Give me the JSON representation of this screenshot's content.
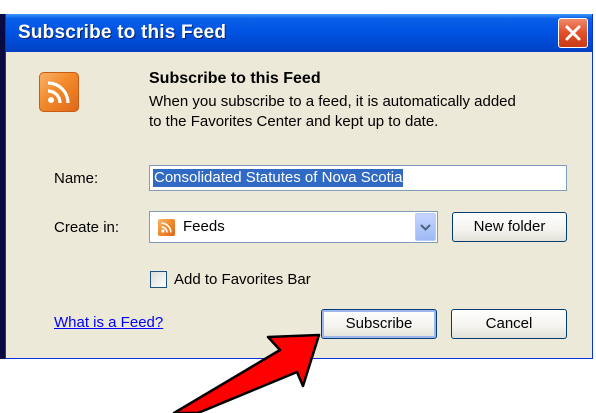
{
  "window": {
    "title": "Subscribe to this Feed",
    "close_label": "Close"
  },
  "header": {
    "title": "Subscribe to this Feed",
    "description_line1": "When you subscribe to a feed, it is automatically added",
    "description_line2": "to the Favorites Center and kept up to date."
  },
  "form": {
    "name_label": "Name:",
    "name_value": "Consolidated Statutes of Nova Scotia",
    "create_in_label": "Create in:",
    "create_in_value": "Feeds",
    "new_folder_label": "New folder",
    "favorites_bar_label": "Add to Favorites Bar",
    "favorites_bar_checked": false
  },
  "footer": {
    "help_link": "What is a Feed?",
    "subscribe_label": "Subscribe",
    "cancel_label": "Cancel"
  },
  "icons": {
    "feed": "rss-feed-icon",
    "close": "close-icon",
    "dropdown": "chevron-down-icon",
    "annotation": "red-arrow-icon"
  },
  "colors": {
    "titlebar": "#0054e3",
    "dialog_bg": "#ece9d8",
    "rss_orange": "#f28a2a",
    "selection": "#316ac5",
    "link": "#0000ff",
    "arrow": "#ff0000"
  }
}
